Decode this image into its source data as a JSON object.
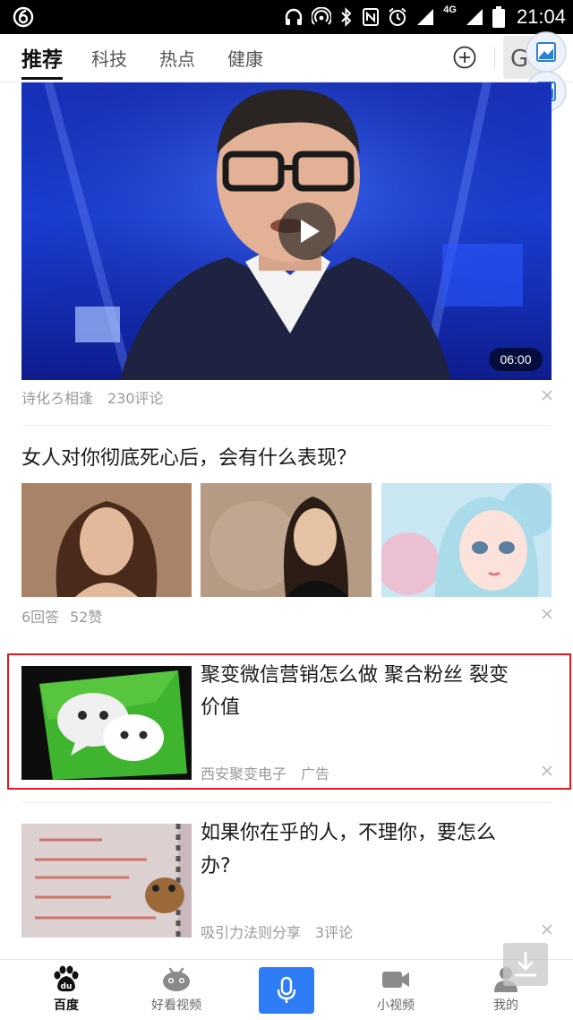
{
  "status_bar": {
    "time": "21:04",
    "network": "4G"
  },
  "tabs": [
    {
      "label": "推荐",
      "active": true
    },
    {
      "label": "科技",
      "active": false
    },
    {
      "label": "热点",
      "active": false
    },
    {
      "label": "健康",
      "active": false
    }
  ],
  "feed": {
    "video_card": {
      "duration": "06:00",
      "author": "诗化ろ相逢",
      "comments": "230评论"
    },
    "question_card": {
      "title": "女人对你彻底死心后，会有什么表现？",
      "answers": "6回答",
      "likes": "52赞"
    },
    "ad_card": {
      "title_line1": "聚变微信营销怎么做 聚合粉丝 裂变",
      "title_line2": "价值",
      "advertiser": "西安聚变电子",
      "ad_label": "广告",
      "highlight_color": "#e01b22"
    },
    "article_card": {
      "title_line1": "如果你在乎的人，不理你，要怎么",
      "title_line2": "办?",
      "source": "吸引力法则分享",
      "comments": "3评论"
    }
  },
  "bottom_nav": [
    {
      "label": "百度",
      "icon": "baidu-paw-icon",
      "active": true
    },
    {
      "label": "好看视频",
      "icon": "haokan-icon",
      "active": false
    },
    {
      "label": "",
      "icon": "microphone-icon",
      "active": false
    },
    {
      "label": "小视频",
      "icon": "video-camera-icon",
      "active": false
    },
    {
      "label": "我的",
      "icon": "user-icon",
      "active": false
    }
  ],
  "colors": {
    "accent": "#2e7df7",
    "ad_border": "#e01b22"
  }
}
